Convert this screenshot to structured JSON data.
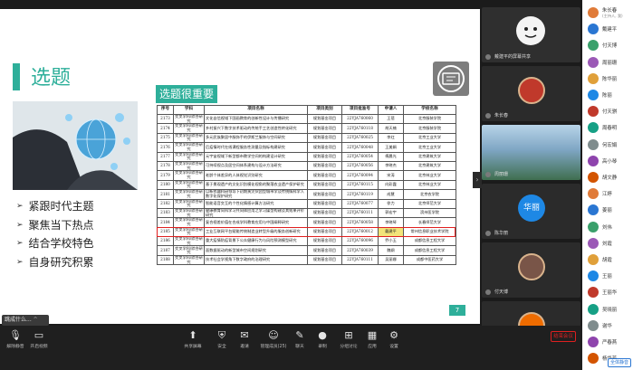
{
  "slide": {
    "title": "选题",
    "table_heading": "选题很重要",
    "bullets": [
      "紧跟时代主题",
      "聚焦当下热点",
      "结合学校特色",
      "自身研究积累"
    ],
    "page_number": "7",
    "table": {
      "headers": [
        "序号",
        "学科",
        "项目名称",
        "项目类别",
        "项目批准号",
        "申请人",
        "学校名称"
      ],
      "rows": [
        [
          "2173",
          "交叉学科/综合研究",
          "文化自信视域下国画教育的创新性设计与传播研究",
          "规划基金项目",
          "22YJA760060",
          "王蓓",
          "北京服装学院"
        ],
        [
          "2174",
          "交叉学科/综合研究",
          "乡村振兴下数字技术驱动的传统手工艺创造性转化研究",
          "规划基金项目",
          "22YJA760118",
          "胡天楠",
          "北京服装学院"
        ],
        [
          "2175",
          "交叉学科/综合研究",
          "多元民族聚居中服饰手的伊斯兰服饰与空间研究",
          "规划基金项目",
          "22YJA760025",
          "李红",
          "北京工业大学"
        ],
        [
          "2176",
          "交叉学科/综合研究",
          "后疫情时代在线课程服务性测量及指标构建研究",
          "规划基金项目",
          "22YJA760048",
          "王美娟",
          "北京工业大学"
        ],
        [
          "2177",
          "交叉学科/综合研究",
          "元宇宙视域下新型都市教学空间的构建设计研究",
          "规划基金项目",
          "22YJA760054",
          "傅晨光",
          "北京建筑大学"
        ],
        [
          "2178",
          "交叉学科/综合研究",
          "可持续视点及居空间体系建构与设计方法研究",
          "规划基金项目",
          "22YJA760056",
          "李晓杰",
          "北京建筑大学"
        ],
        [
          "2179",
          "交叉学科/综合研究",
          "老龄个体差异的人体视觉识别研究",
          "规划基金项目",
          "22YJA760094",
          "宋涛",
          "北京林业大学"
        ],
        [
          "2180",
          "交叉学科/综合研究",
          "基于景观遗产的文化识别模化视角的聚落农业遗产保护研究",
          "规划基金项目",
          "22YJA760115",
          "向彩霞",
          "北京林业大学"
        ],
        [
          "2181",
          "交叉学科/综合研究",
          "以新农疆科研领导下初期黄灾伙团型城市学及传统情科学人数字化保护研究",
          "规划基金项目",
          "22YJA760119",
          "成慧",
          "北京农学院"
        ],
        [
          "2182",
          "交叉学科/综合研究",
          "智能语音交互的个性化情感计算方法研究",
          "规划基金项目",
          "22YJA760077",
          "徐力",
          "北京师范大学"
        ],
        [
          "2183",
          "交叉学科/综合研究",
          "健康教育同科学习共同体应用之学习媒型构建及其效果评价研究",
          "规划基金项目",
          "22YJA760111",
          "郭宏宇",
          "滨州医学院"
        ],
        [
          "2184",
          "交叉学科/综合研究",
          "复合视差价值在合成学科教育应用与中国阐释研究",
          "规划基金项目",
          "22YJA760058",
          "李晓琴",
          "长春师范大学"
        ],
        [
          "2185",
          "交叉学科/综合研究",
          "工业互联网平台赋能传统制造业转型升级的服务创新研究",
          "规划基金项目",
          "22YJA760012",
          "戴建平",
          "常州信息职业技术学院"
        ],
        [
          "2186",
          "交叉学科/综合研究",
          "重大疫情防疫背景下公众健康行为与风险预测模型研究",
          "规划基金项目",
          "22YJA760096",
          "乔小玉",
          "成都信息工程大学"
        ],
        [
          "2187",
          "交叉学科/综合研究",
          "面数据驱动的新型城市空间规划研究",
          "规划基金项目",
          "22YJA760039",
          "魏纲",
          "成都信息工程大学"
        ],
        [
          "2188",
          "交叉学科/综合研究",
          "技术社会学视角下数字政府的治理研究",
          "规划基金项目",
          "22YJA760111",
          "吴丽娜",
          "成都中医药大学"
        ]
      ],
      "highlight_index": 12
    }
  },
  "chat_toast": "跳成什么...",
  "videos": [
    {
      "name": "戴建平的屏幕共享",
      "kind": "share"
    },
    {
      "name": "朱长春",
      "kind": "avatar",
      "color": "#c0392b"
    },
    {
      "name": "周丽珊",
      "kind": "landscape"
    },
    {
      "name": "陈华丽",
      "kind": "text",
      "text": "华丽",
      "color": "#1e88e5"
    },
    {
      "name": "付天博",
      "kind": "avatar",
      "color": "#795548"
    },
    {
      "name": "吴晓丽",
      "kind": "avatar",
      "color": "#ef6c00"
    }
  ],
  "participants": [
    {
      "name": "朱长春",
      "sub": "(主持人, 我)"
    },
    {
      "name": "戴建平"
    },
    {
      "name": "付天博"
    },
    {
      "name": "周丽珊"
    },
    {
      "name": "陈华丽"
    },
    {
      "name": "陈丽"
    },
    {
      "name": "付天骐"
    },
    {
      "name": "周春明"
    },
    {
      "name": "何宏娟"
    },
    {
      "name": "高小琴"
    },
    {
      "name": "胡文静"
    },
    {
      "name": "江婷"
    },
    {
      "name": "姜丽"
    },
    {
      "name": "刘伟"
    },
    {
      "name": "刘霞"
    },
    {
      "name": "胡霞"
    },
    {
      "name": "王丽"
    },
    {
      "name": "王丽华"
    },
    {
      "name": "吴晓丽"
    },
    {
      "name": "谢华"
    },
    {
      "name": "严春燕"
    },
    {
      "name": "杨华芳"
    }
  ],
  "toolbar": {
    "items": [
      "解除静音",
      "开启视频",
      "共享屏幕",
      "安全",
      "邀请",
      "管理成员(25)",
      "聊天",
      "录制",
      "分组讨论",
      "应用",
      "设置"
    ],
    "end_meeting": "结束会议",
    "mute_all": "全体静音"
  },
  "colors": {
    "accent": "#2eaf9a",
    "highlight_border": "#e02020",
    "highlight_fill": "#f2e47a"
  }
}
